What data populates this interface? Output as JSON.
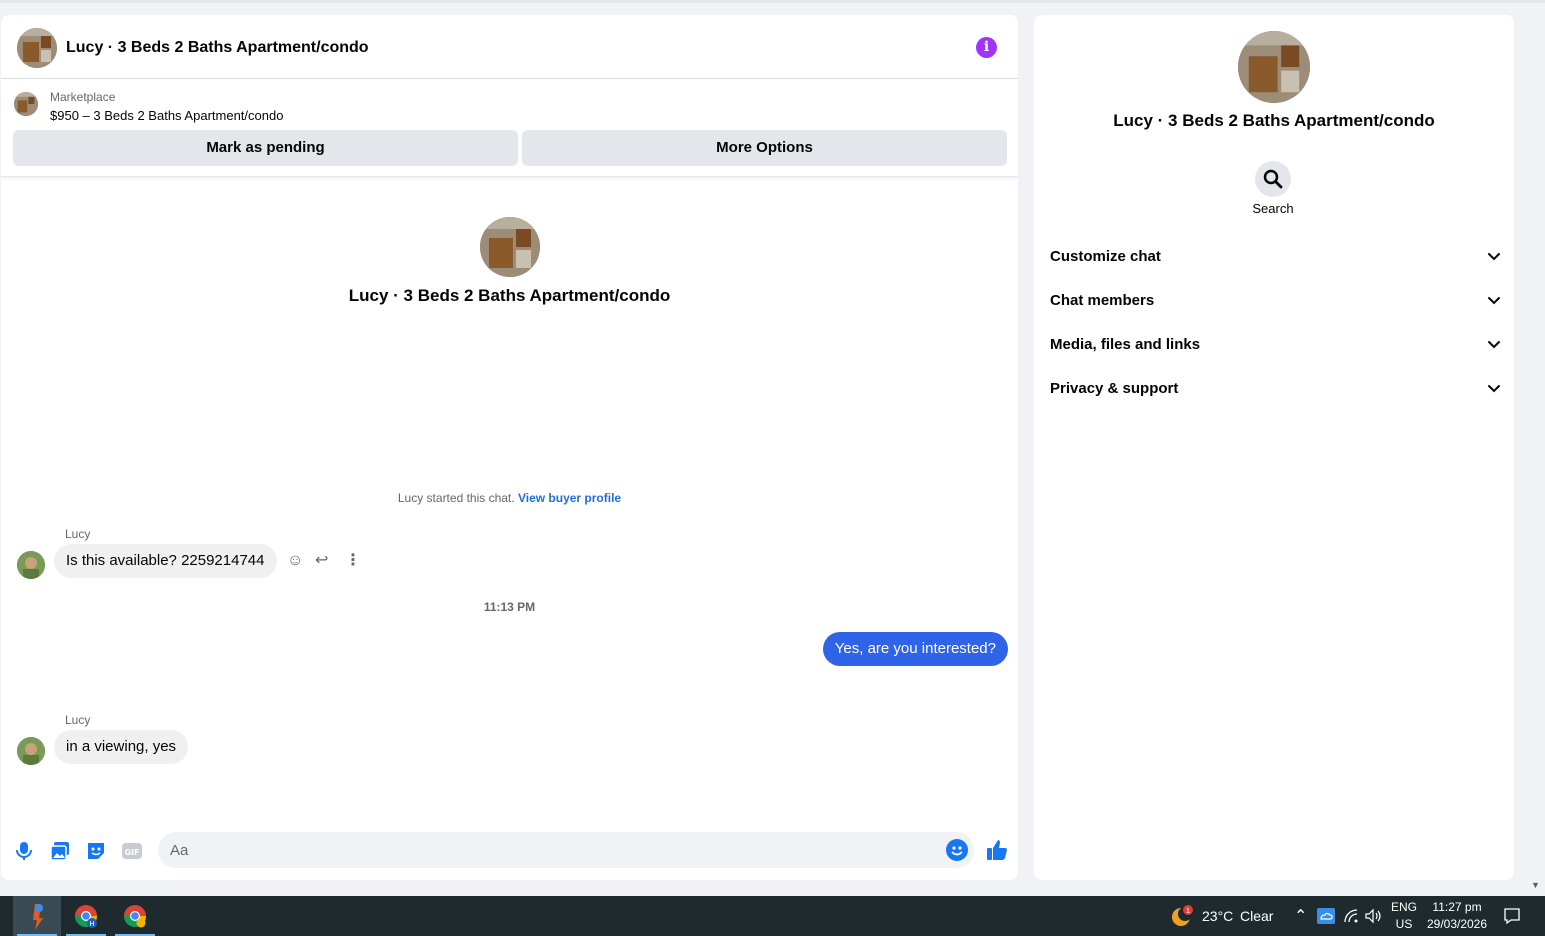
{
  "chat": {
    "title": "Lucy · 3 Beds 2 Baths Apartment/condo",
    "marketplace_label": "Marketplace",
    "listing": "$950 – 3 Beds 2 Baths Apartment/condo",
    "mark_pending_label": "Mark as pending",
    "more_options_label": "More Options",
    "intro_title": "Lucy · 3 Beds 2 Baths Apartment/condo",
    "system_text": "Lucy started this chat.",
    "system_link": "View buyer profile",
    "messages": [
      {
        "sender": "Lucy",
        "text": "Is this available? 2259214744"
      },
      {
        "timestamp": "11:13 PM"
      },
      {
        "sender": "me",
        "text": "Yes, are you interested?"
      },
      {
        "sender": "Lucy",
        "text": "in a viewing, yes"
      }
    ],
    "composer_placeholder": "Aa"
  },
  "details": {
    "title": "Lucy · 3 Beds 2 Baths Apartment/condo",
    "search_label": "Search",
    "sections": [
      {
        "label": "Customize chat"
      },
      {
        "label": "Chat members"
      },
      {
        "label": "Media, files and links"
      },
      {
        "label": "Privacy & support"
      }
    ]
  },
  "taskbar": {
    "weather_temp": "23°C",
    "weather_desc": "Clear",
    "weather_badge": "1",
    "lang_top": "ENG",
    "lang_bottom": "US",
    "time": "11:27 pm",
    "date": "29/03/2026"
  },
  "colors": {
    "accent": "#1877f2",
    "outgoing_bubble": "#2f64e8",
    "info_icon": "#a033ff"
  }
}
